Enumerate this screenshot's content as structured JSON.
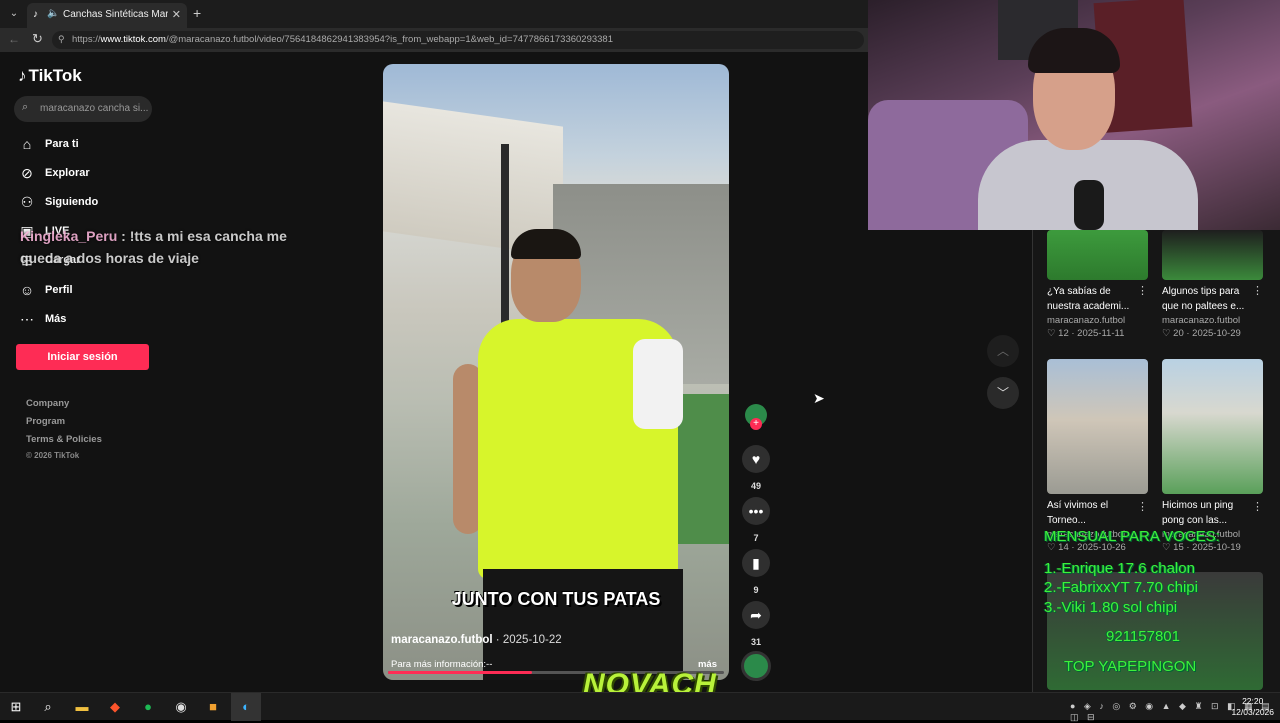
{
  "browser": {
    "tab_title": "Canchas Sintéticas Maracanaz...",
    "url_prefix": "https://",
    "url_host": "www.tiktok.com",
    "url_rest": "/@maracanazo.futbol/video/7564184862941383954?is_from_webapp=1&web_id=7477866173360293381"
  },
  "sidebar": {
    "logo": "TikTok",
    "search_placeholder": "maracanazo cancha si...",
    "nav": [
      {
        "label": "Para ti",
        "icon": "home-icon"
      },
      {
        "label": "Explorar",
        "icon": "compass-icon"
      },
      {
        "label": "Siguiendo",
        "icon": "following-icon"
      },
      {
        "label": "LIVE",
        "icon": "live-icon"
      },
      {
        "label": "Cargar",
        "icon": "upload-icon"
      },
      {
        "label": "Perfil",
        "icon": "profile-icon"
      },
      {
        "label": "Más",
        "icon": "more-icon"
      }
    ],
    "login_button": "Iniciar sesión",
    "footer": [
      "Company",
      "Program",
      "Terms & Policies"
    ],
    "copyright": "© 2026 TikTok"
  },
  "chat_overlay": {
    "user": "Kingleka_Peru",
    "message": " : !tts a mi esa cancha me queda a dos horas de viaje"
  },
  "video": {
    "caption": "JUNTO CON TUS PATAS",
    "author": "maracanazo.futbol",
    "date": " · 2025-10-22",
    "description": "Para más información:-- ",
    "more": "más",
    "progress": 0.43
  },
  "actions": {
    "likes": "49",
    "comments": "7",
    "saves": "9",
    "shares": "31"
  },
  "related": [
    {
      "title": "¿Ya sabías de nuestra academi...",
      "user": "maracanazo.futbol",
      "stats": "♡ 12  ·  2025-11-11"
    },
    {
      "title": "Algunos tips para que no paltees e...",
      "user": "maracanazo.futbol",
      "stats": "♡ 20  ·  2025-10-29"
    },
    {
      "title": "Así vivimos el Torneo...",
      "user": "maracanazo.futbol",
      "stats": "♡ 14  ·  2025-10-26"
    },
    {
      "title": "Hicimos un ping pong con las...",
      "user": "maracanazo.futbol",
      "stats": "♡ 15  ·  2025-10-19"
    }
  ],
  "stream_overlay": {
    "title": "MENSUAL PARA VOCES:",
    "line1": "1.-Enrique 17.6 chalon",
    "line2": "2.-FabrixxYT 7.70 chipi",
    "line3": "3.-Viki 1.80 sol chipi",
    "phone": "921157801",
    "footer": "TOP YAPEPINGON",
    "streamer": "NOVACH"
  },
  "taskbar": {
    "time": "22:20",
    "date": "12/03/2026"
  }
}
